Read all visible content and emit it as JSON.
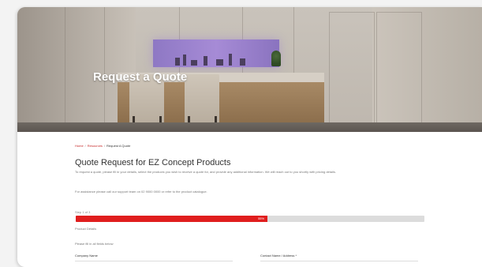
{
  "hero": {
    "title": "Request a Quote"
  },
  "breadcrumb": {
    "items": [
      "Home",
      "Resources"
    ],
    "current": "Request A Quote"
  },
  "page": {
    "title": "Quote Request for EZ Concept Products",
    "intro": "To request a quote, please fill in your details, select the products you wish to receive a quote for, and provide any additional information. We will reach out to you shortly with pricing details.",
    "note": "For assistance please call our support team on 02 9000 0000 or refer to the product catalogue."
  },
  "progress": {
    "step_label": "Step 1 of 3",
    "percent": 55,
    "percent_label": "55%",
    "step_name": "Product Details"
  },
  "form": {
    "section_label": "Please fill in all fields below",
    "fields": [
      {
        "label": "Company Name"
      },
      {
        "label": "Contact Name / Address *"
      }
    ]
  },
  "colors": {
    "accent": "#e01e1e",
    "breadcrumb": "#c62828",
    "track": "#dcdcdc"
  }
}
